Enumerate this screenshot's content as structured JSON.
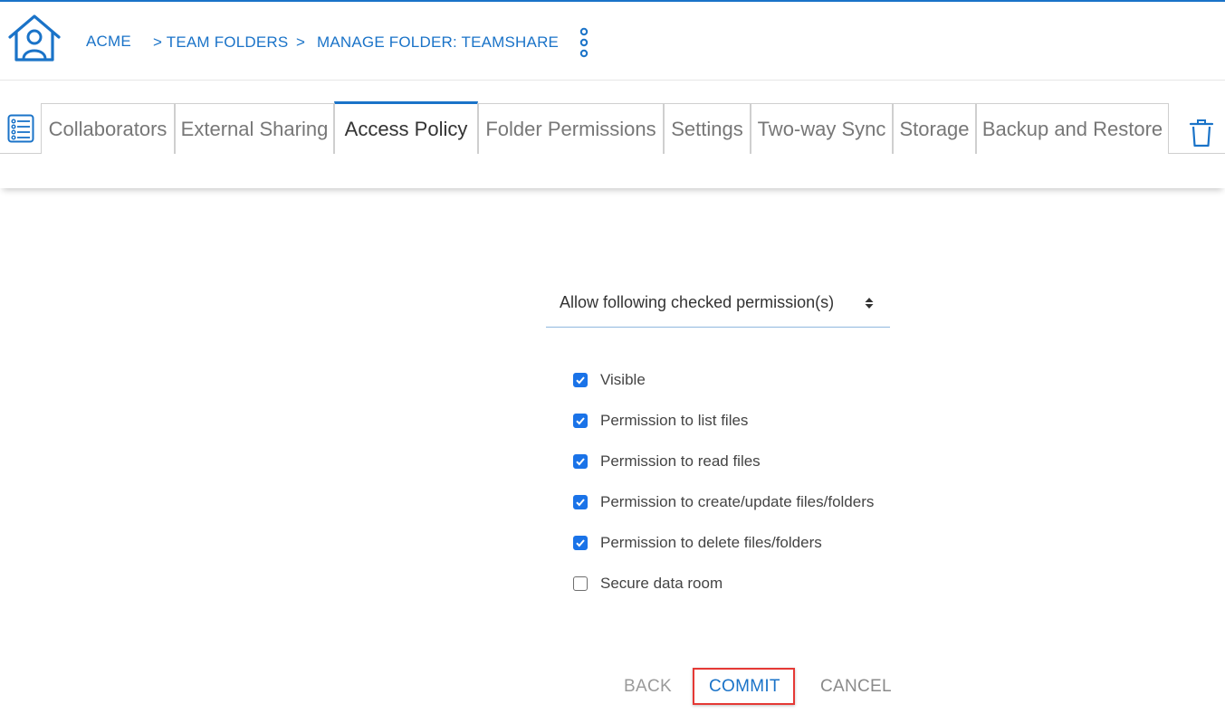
{
  "breadcrumb": {
    "home": "ACME",
    "team_folders": "> TEAM FOLDERS",
    "separator": ">",
    "current": "MANAGE FOLDER: TEAMSHARE"
  },
  "tabs": [
    {
      "label": "Collaborators",
      "active": false
    },
    {
      "label": "External Sharing",
      "active": false
    },
    {
      "label": "Access Policy",
      "active": true
    },
    {
      "label": "Folder Permissions",
      "active": false
    },
    {
      "label": "Settings",
      "active": false
    },
    {
      "label": "Two-way Sync",
      "active": false
    },
    {
      "label": "Storage",
      "active": false
    },
    {
      "label": "Backup and Restore",
      "active": false
    }
  ],
  "policy_select": {
    "value": "Allow following checked permission(s)"
  },
  "permissions": [
    {
      "label": "Visible",
      "checked": true
    },
    {
      "label": "Permission to list files",
      "checked": true
    },
    {
      "label": "Permission to read files",
      "checked": true
    },
    {
      "label": "Permission to create/update files/folders",
      "checked": true
    },
    {
      "label": "Permission to delete files/folders",
      "checked": true
    },
    {
      "label": "Secure data room",
      "checked": false
    }
  ],
  "actions": {
    "back": "BACK",
    "commit": "COMMIT",
    "cancel": "CANCEL"
  },
  "colors": {
    "accent": "#1a73c8",
    "checkbox": "#1a73e8",
    "highlight": "#e53935"
  },
  "icons": [
    "home-user-icon",
    "kebab-menu-icon",
    "list-icon",
    "trash-icon",
    "sort-arrows-icon",
    "checkmark-icon"
  ]
}
